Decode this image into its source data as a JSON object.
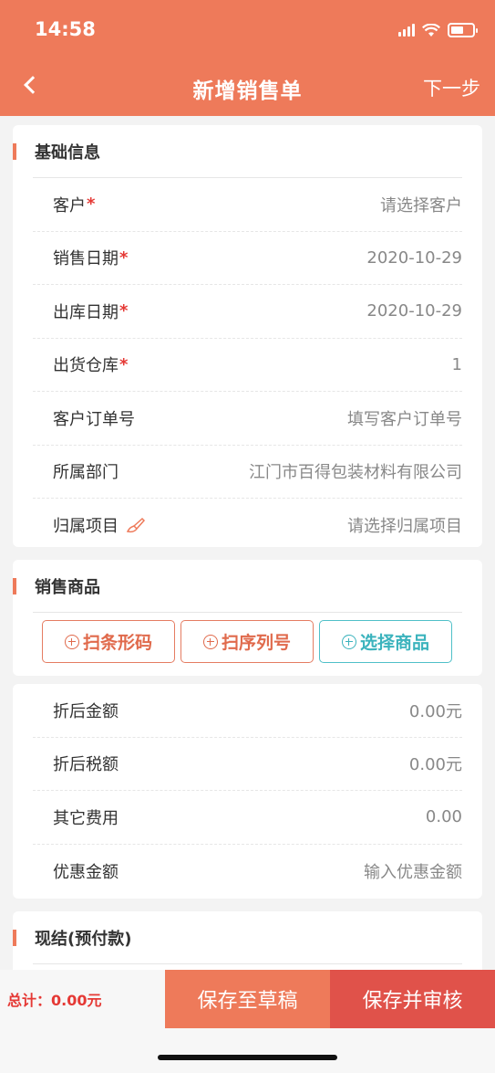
{
  "status_bar": {
    "time": "14:58"
  },
  "nav": {
    "title": "新增销售单",
    "next_label": "下一步"
  },
  "basic_info": {
    "title": "基础信息",
    "rows": [
      {
        "label": "客户",
        "required": "*",
        "value": "请选择客户"
      },
      {
        "label": "销售日期",
        "required": "*",
        "value": "2020-10-29"
      },
      {
        "label": "出库日期",
        "required": "*",
        "value": "2020-10-29"
      },
      {
        "label": "出货仓库",
        "required": "*",
        "value": "1"
      },
      {
        "label": "客户订单号",
        "value": "填写客户订单号"
      },
      {
        "label": "所属部门",
        "value": "江门市百得包装材料有限公司"
      },
      {
        "label": "归属项目",
        "value": "请选择归属项目"
      }
    ]
  },
  "products": {
    "title": "销售商品",
    "scan_barcode": "扫条形码",
    "scan_serial": "扫序列号",
    "select_product": "选择商品"
  },
  "amounts": {
    "rows": [
      {
        "label": "折后金额",
        "value": "0.00元"
      },
      {
        "label": "折后税额",
        "value": "0.00元"
      },
      {
        "label": "其它费用",
        "value": "0.00"
      },
      {
        "label": "优惠金额",
        "value": "输入优惠金额"
      }
    ]
  },
  "settlement": {
    "title": "现结(预付款)"
  },
  "bottom": {
    "total": "总计：0.00元",
    "save_draft": "保存至草稿",
    "save_approve": "保存并审核"
  },
  "colors": {
    "accent": "#ee7a5a",
    "approve": "#e0524a",
    "teal": "#4fc0c8",
    "required": "#e53935"
  }
}
